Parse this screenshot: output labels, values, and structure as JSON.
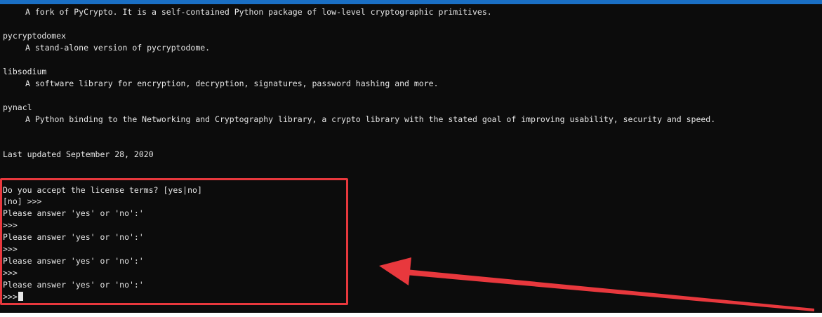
{
  "terminal": {
    "lines": [
      "A fork of PyCrypto. It is a self-contained Python package of low-level cryptographic primitives.",
      "pycryptodomex",
      "A stand-alone version of pycryptodome.",
      "libsodium",
      "A software library for encryption, decryption, signatures, password hashing and more.",
      "pynacl",
      "A Python binding to the Networking and Cryptography library, a crypto library with the stated goal of improving usability, security and speed.",
      "Last updated September 28, 2020",
      "Do you accept the license terms? [yes|no]",
      "[no] >>>",
      "Please answer 'yes' or 'no':'",
      ">>>",
      "Please answer 'yes' or 'no':'",
      ">>>",
      "Please answer 'yes' or 'no':'",
      ">>>",
      "Please answer 'yes' or 'no':'",
      ">>>"
    ]
  },
  "annotation": {
    "box_color": "#e8383d",
    "arrow_color": "#e8383d"
  },
  "colors": {
    "terminal_bg": "#0c0c0c",
    "terminal_fg": "#e6e6e6",
    "title_accent": "#1a6fc4"
  }
}
